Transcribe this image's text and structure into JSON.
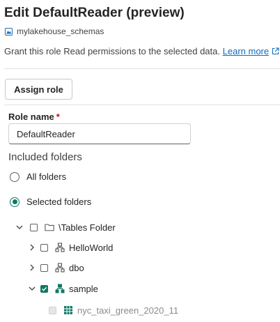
{
  "header": {
    "title": "Edit DefaultReader (preview)",
    "lakehouse": "mylakehouse_schemas",
    "lakehouse_icon": "lakehouse-icon",
    "description": "Grant this role Read permissions to the selected data.",
    "learn_more": "Learn more",
    "learn_more_icon": "external-link-icon"
  },
  "toolbar": {
    "assign_role_label": "Assign role"
  },
  "form": {
    "role_name_label": "Role name",
    "required_marker": "*",
    "role_name_value": "DefaultReader",
    "included_folders_label": "Included folders",
    "options": [
      {
        "label": "All folders",
        "checked": false
      },
      {
        "label": "Selected folders",
        "checked": true
      }
    ]
  },
  "tree": {
    "root": {
      "label": "\\Tables Folder",
      "icon": "folder-icon",
      "expanded": true,
      "checked": false
    },
    "items": [
      {
        "label": "HelloWorld",
        "icon": "schema-icon",
        "expanded": false,
        "checked": false
      },
      {
        "label": "dbo",
        "icon": "schema-icon",
        "expanded": false,
        "checked": false
      },
      {
        "label": "sample",
        "icon": "schema-icon",
        "expanded": true,
        "checked": true
      }
    ],
    "child": {
      "label": "nyc_taxi_green_2020_11",
      "icon": "table-icon",
      "checked": true,
      "disabled": true
    }
  },
  "colors": {
    "accent": "#117865",
    "link": "#0f6cbd",
    "required": "#c50f1f"
  }
}
